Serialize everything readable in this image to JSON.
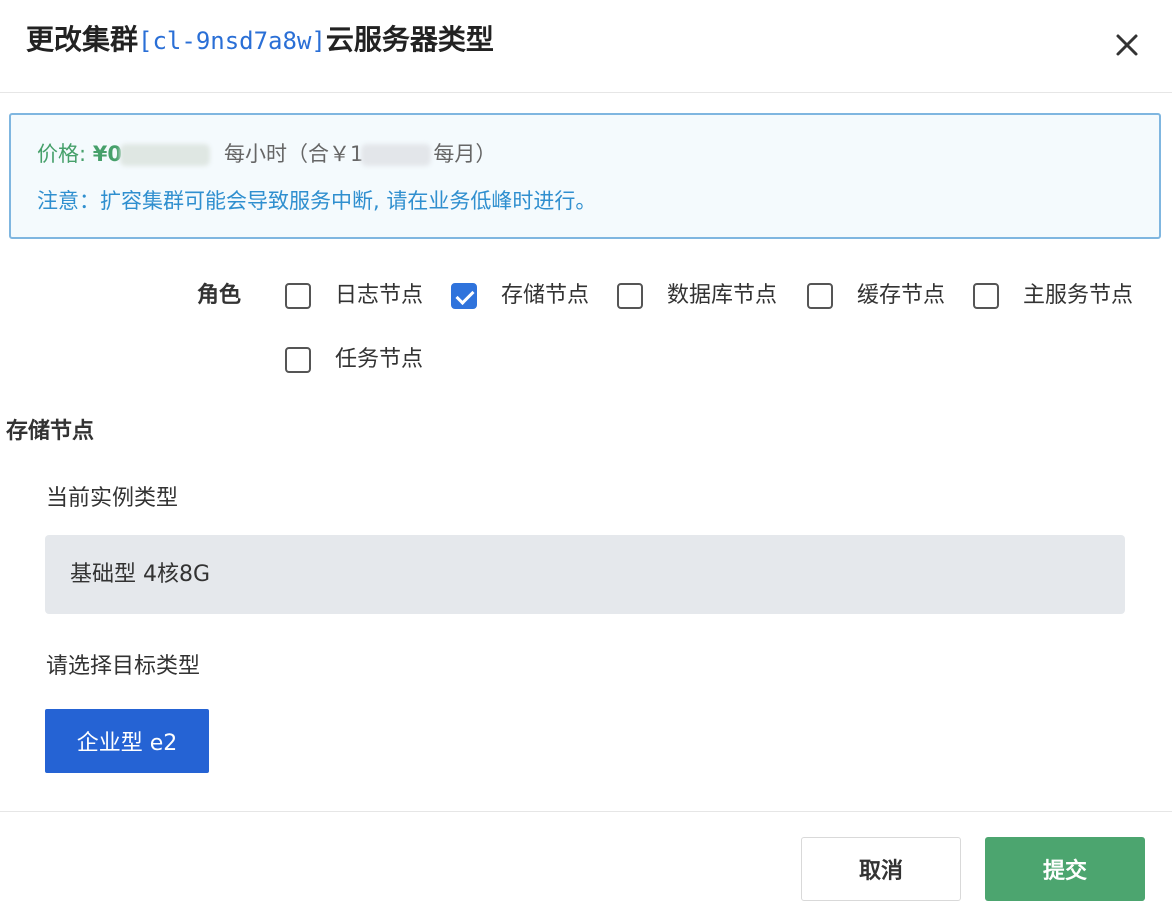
{
  "dialog": {
    "title_prefix": "更改集群",
    "cluster_id": "[cl-9nsd7a8w]",
    "title_suffix": "云服务器类型",
    "close_icon": "close-icon"
  },
  "notice": {
    "price_label": "价格: ",
    "price_value": "¥0",
    "per_hour": "每小时（合￥1",
    "per_month": "每月）",
    "warning": "注意：扩容集群可能会导致服务中断, 请在业务低峰时进行。"
  },
  "roles": {
    "label": "角色",
    "items": [
      {
        "label": "日志节点",
        "checked": false
      },
      {
        "label": "存储节点",
        "checked": true
      },
      {
        "label": "数据库节点",
        "checked": false
      },
      {
        "label": "缓存节点",
        "checked": false
      },
      {
        "label": "主服务节点",
        "checked": false
      },
      {
        "label": "任务节点",
        "checked": false
      }
    ]
  },
  "section": {
    "title": "存储节点",
    "current_label": "当前实例类型",
    "current_value": "基础型 4核8G",
    "target_label": "请选择目标类型",
    "target_option": "企业型 e2"
  },
  "footer": {
    "cancel_label": "取消",
    "submit_label": "提交"
  },
  "colors": {
    "accent_blue": "#2563d4",
    "submit_green": "#4ca56f",
    "price_green": "#46a06a",
    "notice_blue": "#2f8fcf"
  }
}
